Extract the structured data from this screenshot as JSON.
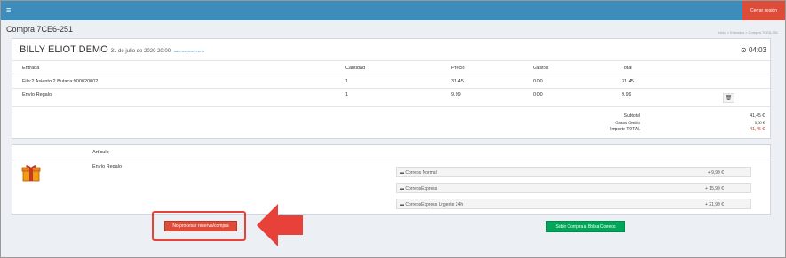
{
  "header": {
    "menu_icon": "≡",
    "logout_label": "Cerrar sesión",
    "brand_color": "#3c8dbc"
  },
  "page": {
    "title": "Compra 7CE6-251",
    "breadcrumb": "Inicio > Entradas > Compra 7CE6-251"
  },
  "event": {
    "title": "BILLY ELIOT DEMO",
    "date": "31 de julio de 2020 20:00",
    "sub": "Teatro 12345678 51:45:56",
    "timer": "04:03"
  },
  "order_table": {
    "headers": [
      "Entrada",
      "Cantidad",
      "Precio",
      "Gastos",
      "Total"
    ],
    "rows": [
      [
        "Fila:2 Asiento:2 Butaca:900020002",
        "1",
        "31.45",
        "0.00",
        "31.45"
      ],
      [
        "Envío Regalo",
        "1",
        "9.99",
        "0.00",
        "9.99"
      ]
    ]
  },
  "totals": {
    "subtotal_label": "Subtotal",
    "subtotal_value": "41,45 €",
    "fees_label": "Gastos Gestión",
    "fees_value": "0,00 €",
    "total_label": "Importe TOTAL",
    "total_value": "41,45 €"
  },
  "article": {
    "header": "Artículo",
    "item": "Envío Regalo",
    "icon": "gift-icon",
    "options": [
      {
        "name": "Correos Normal",
        "price": "+ 9,99 €"
      },
      {
        "name": "CorreosExpress",
        "price": "+ 15,99 €"
      },
      {
        "name": "CorreosExpress Urgente 24h",
        "price": "+ 21,99 €"
      }
    ]
  },
  "actions": {
    "cancel_label": "No procesar reserva/compra",
    "submit_label": "Subir Compra a Bolsa Correos"
  },
  "colors": {
    "danger": "#dd4b39",
    "success": "#00a65a",
    "highlight": "#e8413a"
  }
}
